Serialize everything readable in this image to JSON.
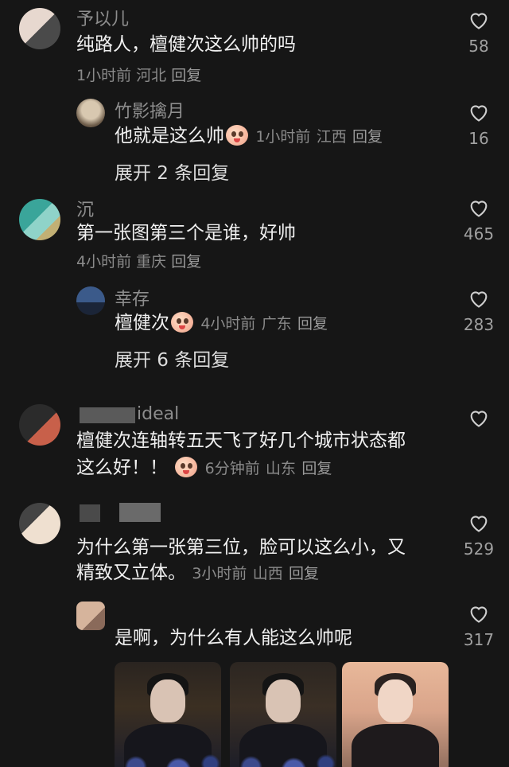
{
  "comments": [
    {
      "username": "予以儿",
      "text": "纯路人，檀健次这么帅的吗",
      "time": "1小时前",
      "location": "河北",
      "reply_label": "回复",
      "likes": "58"
    },
    {
      "username": "竹影擒月",
      "text": "他就是这么帅",
      "time": "1小时前",
      "location": "江西",
      "reply_label": "回复",
      "likes": "16"
    },
    {
      "expand_label": "展开 2 条回复"
    },
    {
      "username": "沉",
      "text": "第一张图第三个是谁，好帅",
      "time": "4小时前",
      "location": "重庆",
      "reply_label": "回复",
      "likes": "465"
    },
    {
      "username": "幸存",
      "text": "檀健次",
      "time": "4小时前",
      "location": "广东",
      "reply_label": "回复",
      "likes": "283"
    },
    {
      "expand_label": "展开 6 条回复"
    },
    {
      "username": "ideal",
      "text_line1": "檀健次连轴转五天飞了好几个城市状态都",
      "text_line2": "这么好！！",
      "time": "6分钟前",
      "location": "山东",
      "reply_label": "回复",
      "likes": ""
    },
    {
      "username": "",
      "text_line1": "为什么第一张第三位，脸可以这么小，又",
      "text_line2": "精致又立体。",
      "time": "3小时前",
      "location": "山西",
      "reply_label": "回复",
      "likes": "529"
    },
    {
      "username": "",
      "text": "是啊，为什么有人能这么帅呢",
      "likes": "317"
    }
  ],
  "icons": {
    "like": "heart-outline-icon",
    "emoji": "face-emoji-icon"
  },
  "colors": {
    "background": "#161616",
    "text_primary": "#f0f0f0",
    "text_secondary": "#8a8a8a"
  }
}
